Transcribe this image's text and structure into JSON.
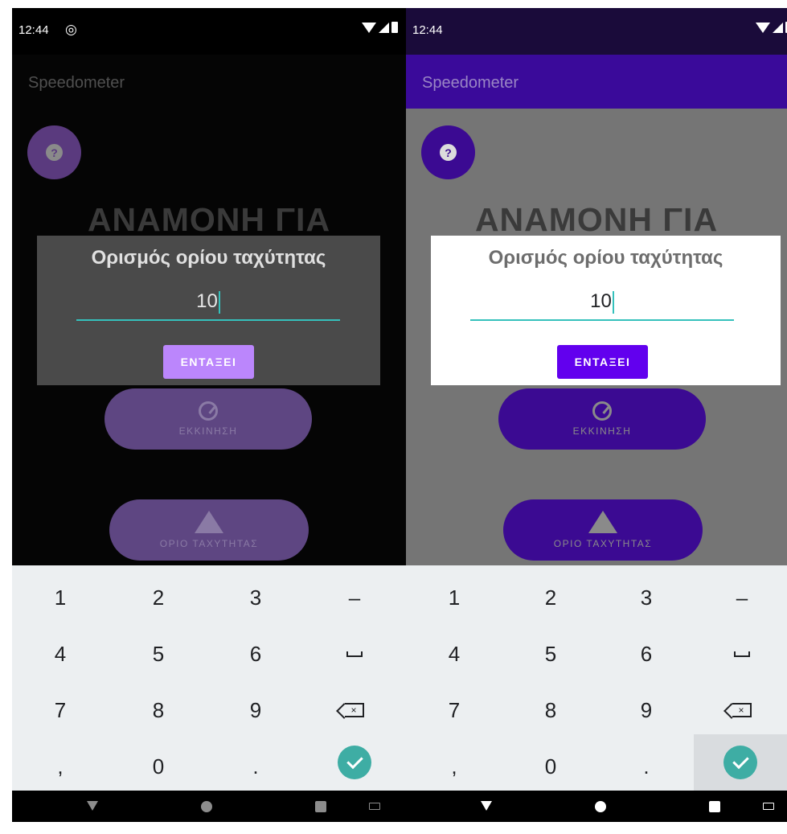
{
  "status_bar": {
    "time": "12:44"
  },
  "app_bar": {
    "title": "Speedometer"
  },
  "help_button": {
    "label": "?"
  },
  "waiting_text": "ΑΝΑΜΟΝΗ ΓΙΑ",
  "start_button": {
    "label": "ΕΚΚΙΝΗΣΗ",
    "icon": "speedometer-icon"
  },
  "limit_button": {
    "label": "ΟΡΙΟ ΤΑΧΥΤΗΤΑΣ",
    "icon": "warning-icon"
  },
  "dialog": {
    "title": "Ορισμός ορίου ταχύτητας",
    "input_value": "10",
    "ok_label": "ΕΝΤΑΞΕΙ"
  },
  "keyboard": {
    "rows": [
      [
        "1",
        "2",
        "3",
        "–"
      ],
      [
        "4",
        "5",
        "6",
        "space"
      ],
      [
        "7",
        "8",
        "9",
        "backspace"
      ],
      [
        ",",
        "0",
        ".",
        "done"
      ]
    ]
  },
  "nav_bar": {
    "icons": [
      "back-icon",
      "home-icon",
      "recents-icon",
      "keyboard-switch-icon"
    ]
  },
  "colors": {
    "accent_dark_theme": "#bb86fc",
    "accent_light_theme": "#6200ee",
    "input_underline": "#35c1bc",
    "done_key": "#3eada4"
  }
}
